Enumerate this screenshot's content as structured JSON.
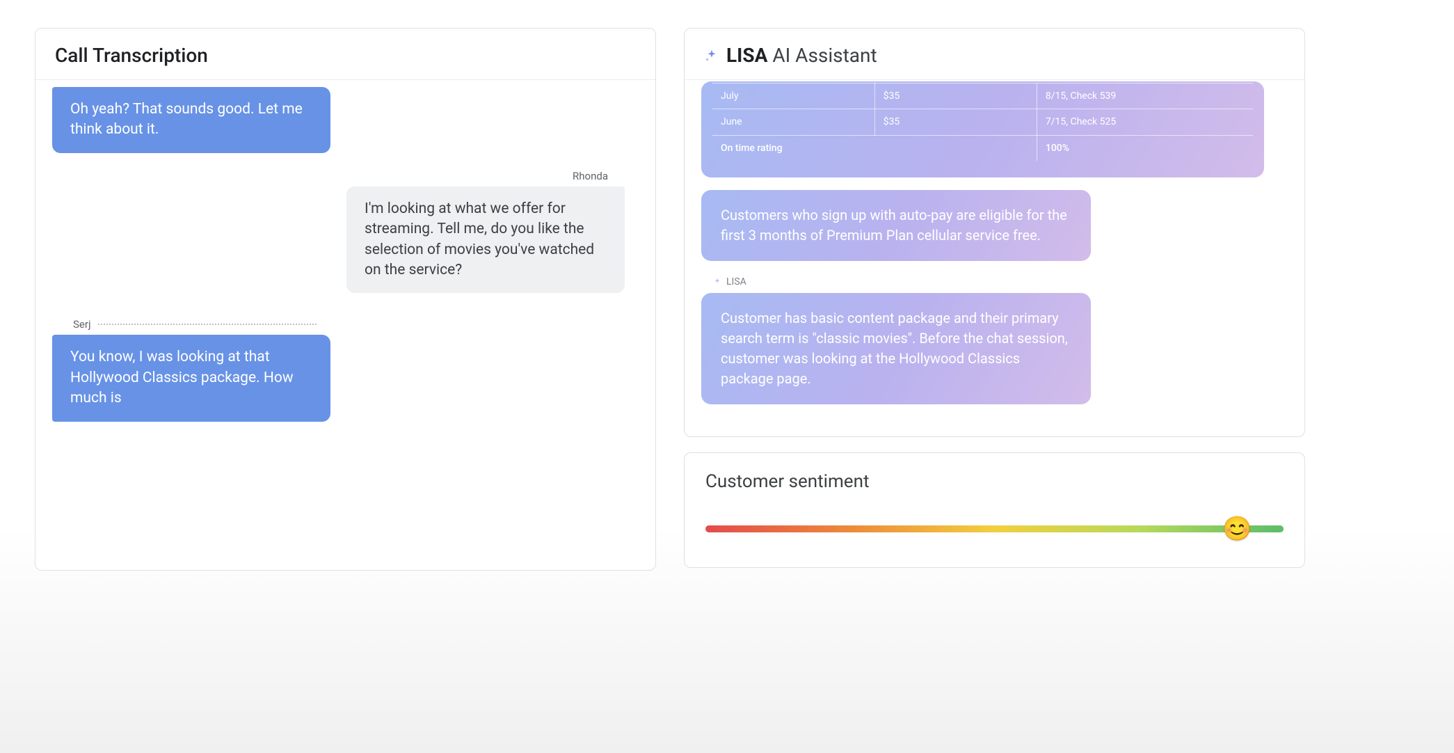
{
  "transcription": {
    "title": "Call Transcription",
    "messages": [
      {
        "role": "customer",
        "speaker": null,
        "text": "Oh yeah? That sounds good. Let me think about it."
      },
      {
        "role": "agent",
        "speaker": "Rhonda",
        "text": "I'm looking at what we offer for streaming. Tell me, do you like the selection of movies you've watched on the service?"
      },
      {
        "role": "customer",
        "speaker": "Serj",
        "text": "You know, I was looking at that Hollywood Classics package. How much is"
      }
    ]
  },
  "lisa": {
    "title_bold": "LISA",
    "title_thin": "AI Assistant",
    "speaker_label": "LISA",
    "payment_table": {
      "rows": [
        {
          "month": "July",
          "amount": "$35",
          "detail": "8/15, Check 539"
        },
        {
          "month": "June",
          "amount": "$35",
          "detail": "7/15, Check 525"
        }
      ],
      "rating_label": "On time rating",
      "rating_value": "100%"
    },
    "cards": [
      "Customers who sign up with auto-pay are eligible for the first 3 months of Premium Plan cellular service free.",
      "Customer has basic content package and their primary search term is \"classic movies\". Before the chat session, customer was looking at the Hollywood Classics package page."
    ]
  },
  "sentiment": {
    "title": "Customer sentiment",
    "value_percent": 92,
    "emoji": "😊"
  }
}
